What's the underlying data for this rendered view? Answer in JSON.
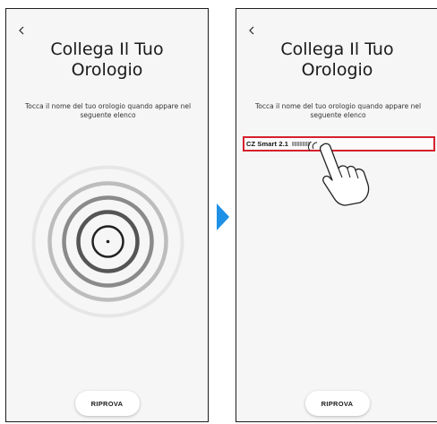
{
  "screens": [
    {
      "title": "Collega Il Tuo\nOrologio",
      "subtitle": "Tocca il nome del tuo orologio quando appare nel seguente elenco",
      "retry_label": "RIPROVA"
    },
    {
      "title": "Collega Il Tuo\nOrologio",
      "subtitle": "Tocca il nome del tuo orologio quando appare nel seguente elenco",
      "device_name": "CZ Smart 2.1",
      "retry_label": "RIPROVA"
    }
  ],
  "icons": {
    "back": "chevron-left-icon",
    "radar": "bluetooth-scan-radar-icon",
    "hand": "tapping-hand-icon",
    "arrow": "next-step-arrow-icon"
  },
  "colors": {
    "highlight": "#d6212e",
    "arrow": "#1e90e6",
    "screen_bg": "#f6f6f6",
    "border": "#1e1e1e"
  }
}
